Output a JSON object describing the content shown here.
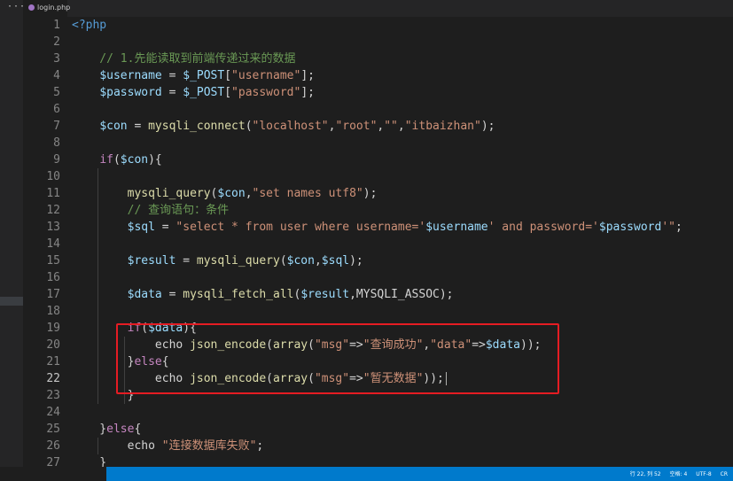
{
  "sidebar": {
    "more_label": "···"
  },
  "tabs": [
    {
      "label": "login.php",
      "icon": "php-file-icon"
    }
  ],
  "lines": [
    {
      "num": "1",
      "tokens": [
        {
          "t": "<?php",
          "c": "tag"
        }
      ]
    },
    {
      "num": "2",
      "tokens": []
    },
    {
      "num": "3",
      "tokens": [
        {
          "t": "    // 1.先能读取到前端传递过来的数据",
          "c": "cmt"
        }
      ]
    },
    {
      "num": "4",
      "tokens": [
        {
          "t": "    ",
          "c": ""
        },
        {
          "t": "$username",
          "c": "var"
        },
        {
          "t": " = ",
          "c": ""
        },
        {
          "t": "$_POST",
          "c": "var"
        },
        {
          "t": "[",
          "c": ""
        },
        {
          "t": "\"username\"",
          "c": "str"
        },
        {
          "t": "];",
          "c": ""
        }
      ]
    },
    {
      "num": "5",
      "tokens": [
        {
          "t": "    ",
          "c": ""
        },
        {
          "t": "$password",
          "c": "var"
        },
        {
          "t": " = ",
          "c": ""
        },
        {
          "t": "$_POST",
          "c": "var"
        },
        {
          "t": "[",
          "c": ""
        },
        {
          "t": "\"password\"",
          "c": "str"
        },
        {
          "t": "];",
          "c": ""
        }
      ]
    },
    {
      "num": "6",
      "tokens": []
    },
    {
      "num": "7",
      "tokens": [
        {
          "t": "    ",
          "c": ""
        },
        {
          "t": "$con",
          "c": "var"
        },
        {
          "t": " = ",
          "c": ""
        },
        {
          "t": "mysqli_connect",
          "c": "fn"
        },
        {
          "t": "(",
          "c": ""
        },
        {
          "t": "\"localhost\"",
          "c": "str"
        },
        {
          "t": ",",
          "c": ""
        },
        {
          "t": "\"root\"",
          "c": "str"
        },
        {
          "t": ",",
          "c": ""
        },
        {
          "t": "\"\"",
          "c": "str"
        },
        {
          "t": ",",
          "c": ""
        },
        {
          "t": "\"itbaizhan\"",
          "c": "str"
        },
        {
          "t": ");",
          "c": ""
        }
      ]
    },
    {
      "num": "8",
      "tokens": []
    },
    {
      "num": "9",
      "tokens": [
        {
          "t": "    ",
          "c": ""
        },
        {
          "t": "if",
          "c": "kw"
        },
        {
          "t": "(",
          "c": ""
        },
        {
          "t": "$con",
          "c": "var"
        },
        {
          "t": "){",
          "c": ""
        }
      ]
    },
    {
      "num": "10",
      "tokens": []
    },
    {
      "num": "11",
      "tokens": [
        {
          "t": "        ",
          "c": ""
        },
        {
          "t": "mysqli_query",
          "c": "fn"
        },
        {
          "t": "(",
          "c": ""
        },
        {
          "t": "$con",
          "c": "var"
        },
        {
          "t": ",",
          "c": ""
        },
        {
          "t": "\"set names utf8\"",
          "c": "str"
        },
        {
          "t": ");",
          "c": ""
        }
      ]
    },
    {
      "num": "12",
      "tokens": [
        {
          "t": "        // 查询语句：条件",
          "c": "cmt"
        }
      ]
    },
    {
      "num": "13",
      "tokens": [
        {
          "t": "        ",
          "c": ""
        },
        {
          "t": "$sql",
          "c": "var"
        },
        {
          "t": " = ",
          "c": ""
        },
        {
          "t": "\"select * from user where username='",
          "c": "str"
        },
        {
          "t": "$username",
          "c": "var"
        },
        {
          "t": "' and password='",
          "c": "str"
        },
        {
          "t": "$password",
          "c": "var"
        },
        {
          "t": "'\"",
          "c": "str"
        },
        {
          "t": ";",
          "c": ""
        }
      ]
    },
    {
      "num": "14",
      "tokens": []
    },
    {
      "num": "15",
      "tokens": [
        {
          "t": "        ",
          "c": ""
        },
        {
          "t": "$result",
          "c": "var"
        },
        {
          "t": " = ",
          "c": ""
        },
        {
          "t": "mysqli_query",
          "c": "fn"
        },
        {
          "t": "(",
          "c": ""
        },
        {
          "t": "$con",
          "c": "var"
        },
        {
          "t": ",",
          "c": ""
        },
        {
          "t": "$sql",
          "c": "var"
        },
        {
          "t": ");",
          "c": ""
        }
      ]
    },
    {
      "num": "16",
      "tokens": []
    },
    {
      "num": "17",
      "tokens": [
        {
          "t": "        ",
          "c": ""
        },
        {
          "t": "$data",
          "c": "var"
        },
        {
          "t": " = ",
          "c": ""
        },
        {
          "t": "mysqli_fetch_all",
          "c": "fn"
        },
        {
          "t": "(",
          "c": ""
        },
        {
          "t": "$result",
          "c": "var"
        },
        {
          "t": ",MYSQLI_ASSOC);",
          "c": ""
        }
      ]
    },
    {
      "num": "18",
      "tokens": []
    },
    {
      "num": "19",
      "tokens": [
        {
          "t": "        ",
          "c": ""
        },
        {
          "t": "if",
          "c": "kw"
        },
        {
          "t": "(",
          "c": ""
        },
        {
          "t": "$data",
          "c": "var"
        },
        {
          "t": "){",
          "c": ""
        }
      ]
    },
    {
      "num": "20",
      "tokens": [
        {
          "t": "            echo ",
          "c": ""
        },
        {
          "t": "json_encode",
          "c": "fn"
        },
        {
          "t": "(",
          "c": ""
        },
        {
          "t": "array",
          "c": "fn"
        },
        {
          "t": "(",
          "c": ""
        },
        {
          "t": "\"msg\"",
          "c": "str"
        },
        {
          "t": "=>",
          "c": ""
        },
        {
          "t": "\"查询成功\"",
          "c": "str"
        },
        {
          "t": ",",
          "c": ""
        },
        {
          "t": "\"data\"",
          "c": "str"
        },
        {
          "t": "=>",
          "c": ""
        },
        {
          "t": "$data",
          "c": "var"
        },
        {
          "t": "));",
          "c": ""
        }
      ]
    },
    {
      "num": "21",
      "tokens": [
        {
          "t": "        }",
          "c": ""
        },
        {
          "t": "else",
          "c": "kw"
        },
        {
          "t": "{",
          "c": ""
        }
      ]
    },
    {
      "num": "22",
      "tokens": [
        {
          "t": "            echo ",
          "c": ""
        },
        {
          "t": "json_encode",
          "c": "fn"
        },
        {
          "t": "(",
          "c": ""
        },
        {
          "t": "array",
          "c": "fn"
        },
        {
          "t": "(",
          "c": ""
        },
        {
          "t": "\"msg\"",
          "c": "str"
        },
        {
          "t": "=>",
          "c": ""
        },
        {
          "t": "\"暂无数据\"",
          "c": "str"
        },
        {
          "t": "));",
          "c": ""
        }
      ],
      "active": true
    },
    {
      "num": "23",
      "tokens": [
        {
          "t": "        }",
          "c": ""
        }
      ]
    },
    {
      "num": "24",
      "tokens": []
    },
    {
      "num": "25",
      "tokens": [
        {
          "t": "    }",
          "c": ""
        },
        {
          "t": "else",
          "c": "kw"
        },
        {
          "t": "{",
          "c": ""
        }
      ]
    },
    {
      "num": "26",
      "tokens": [
        {
          "t": "        echo ",
          "c": ""
        },
        {
          "t": "\"连接数据库失败\"",
          "c": "str"
        },
        {
          "t": ";",
          "c": ""
        }
      ]
    },
    {
      "num": "27",
      "tokens": [
        {
          "t": "    }",
          "c": ""
        }
      ]
    }
  ],
  "status": {
    "position": "行 22, 列 52",
    "spaces": "空格: 4",
    "encoding": "UTF-8",
    "eol": "CR"
  },
  "colors": {
    "accent": "#007acc",
    "highlight_border": "#e51c23",
    "keyword": "#c586c0",
    "variable": "#9cdcfe",
    "function": "#dcdcaa",
    "string": "#ce9178",
    "comment": "#6a9955",
    "php_tag": "#569cd6"
  }
}
